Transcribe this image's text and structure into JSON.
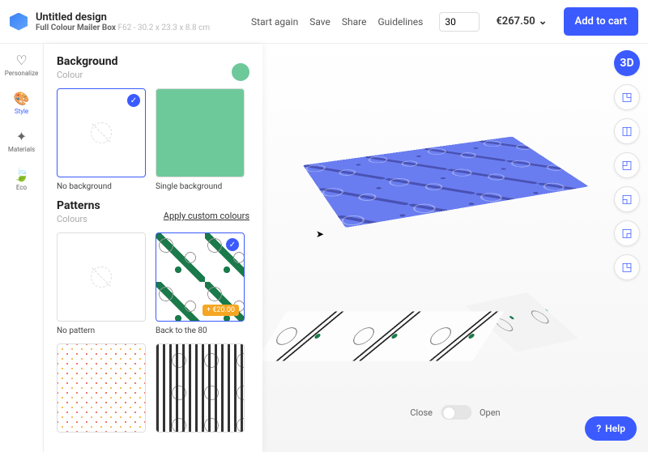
{
  "header": {
    "title": "Untitled design",
    "product": "Full Colour Mailer Box",
    "sku": "F62 - 30.2 x 23.3 x 8.8 cm",
    "links": {
      "start": "Start again",
      "save": "Save",
      "share": "Share",
      "guidelines": "Guidelines"
    },
    "qty": "30",
    "price": "€267.50",
    "add": "Add to cart"
  },
  "sidebar": {
    "personalize": "Personalize",
    "style": "Style",
    "materials": "Materials",
    "eco": "Eco"
  },
  "panel": {
    "bg_heading": "Background",
    "bg_sub": "Colour",
    "no_bg": "No background",
    "single_bg": "Single background",
    "patterns_heading": "Patterns",
    "patterns_sub": "Colours",
    "custom_link": "Apply custom colours",
    "no_pattern": "No pattern",
    "back80": "Back to the 80",
    "price_tag": "+ €20.00"
  },
  "canvas": {
    "close": "Close",
    "open": "Open"
  },
  "tools": {
    "view3d": "3D"
  },
  "help": "Help"
}
